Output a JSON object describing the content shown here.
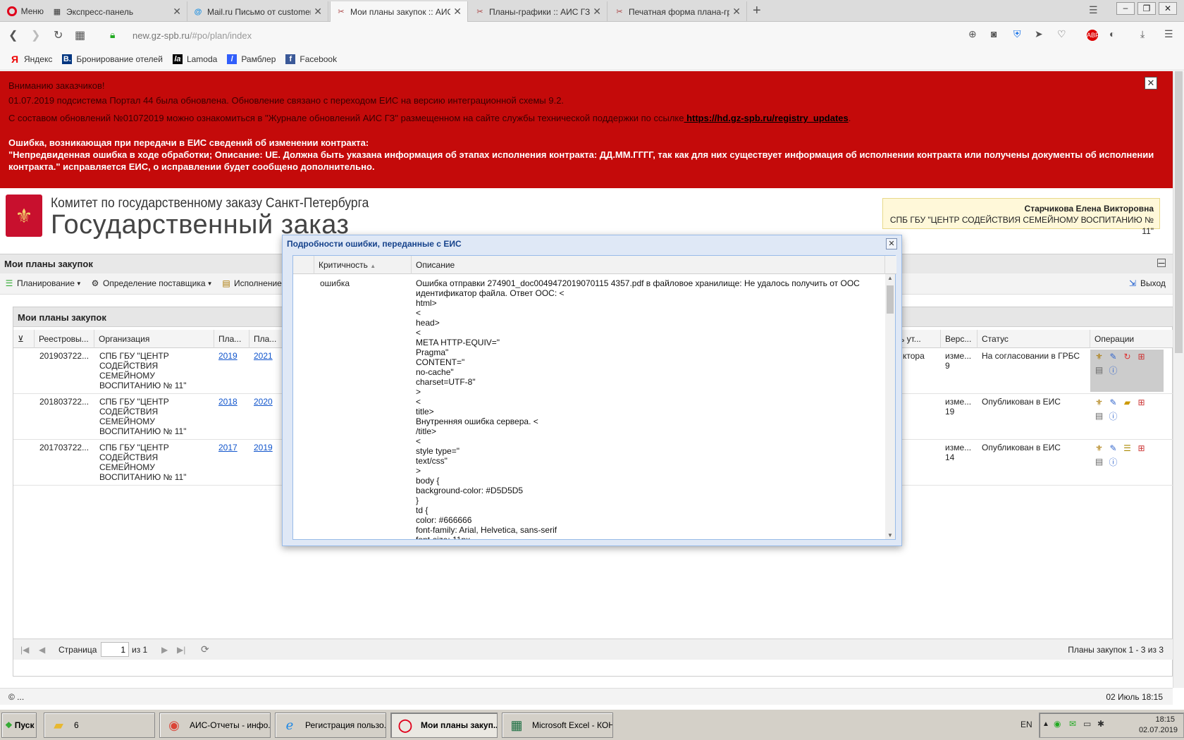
{
  "browser": {
    "menu_label": "Меню",
    "tabs": [
      {
        "title": "Экспресс-панель",
        "icon": "grid-icon"
      },
      {
        "title": "Mail.ru Письмо от customerc",
        "icon": "at-icon"
      },
      {
        "title": "Мои планы закупок :: АИС Г",
        "icon": "tools-icon"
      },
      {
        "title": "Планы-графики :: АИС ГЗ",
        "icon": "tools-icon"
      },
      {
        "title": "Печатная форма плана-граф",
        "icon": "tools-icon"
      }
    ],
    "url_host": "new.gz-spb.ru",
    "url_path": "/#po/plan/index",
    "bookmarks": [
      {
        "label": "Яндекс",
        "color": "#e00"
      },
      {
        "label": "Бронирование отелей",
        "color": "#003580"
      },
      {
        "label": "Lamoda",
        "color": "#000"
      },
      {
        "label": "Рамблер",
        "color": "#315efb"
      },
      {
        "label": "Facebook",
        "color": "#3b5998"
      }
    ]
  },
  "alert": {
    "line1": "Вниманию заказчиков!",
    "line2": "01.07.2019 подсистема Портал 44 была обновлена. Обновление связано с переходом ЕИС на версию интеграционной схемы 9.2.",
    "line3": "С составом обновлений №01072019 можно ознакомиться в \"Журнале обновлений АИС ГЗ\" размещенном на сайте службы технической поддержки по ссылке",
    "link": " https://hd.gz-spb.ru/registry_updates",
    "line3_end": ".",
    "warn_title": "Ошибка, возникающая при передачи в ЕИС сведений об изменении контракта:",
    "warn_body": "\"Непредвиденная ошибка в ходе обработки; Описание: UE. Должна быть указана информация об этапах исполнения контракта: ДД.ММ.ГГГГ, так как для них существует информация об исполнении контракта или получены документы об исполнении контракта.\" исправляется ЕИС, о исправлении будет сообщено дополнительно.",
    "brand_color": "#c40a0a"
  },
  "header": {
    "org_line": "Комитет по государственному заказу Санкт-Петербурга",
    "system_name": "Государственный заказ",
    "user_name": "Старчикова Елена Викторовна",
    "user_org": "СПБ ГБУ \"ЦЕНТР СОДЕЙСТВИЯ СЕМЕЙНОМУ ВОСПИТАНИЮ № 11\""
  },
  "panel": {
    "title": "Мои планы закупок",
    "toolbar": {
      "planning": "Планирование",
      "supplier": "Определение поставщика",
      "execution": "Исполнение",
      "exit": "Выход"
    }
  },
  "grid": {
    "title": "Мои планы закупок",
    "columns": [
      "Реестровы...",
      "Организация",
      "Пла...",
      "Пла...",
      "ь ут...",
      "Верс...",
      "Статус",
      "Операции"
    ],
    "rows": [
      {
        "reg": "201903722...",
        "org": "СПБ ГБУ \"ЦЕНТР\nСОДЕЙСТВИЯ\nСЕМЕЙНОМУ\nВОСПИТАНИЮ № 11\"",
        "y1": "2019",
        "y2": "2021",
        "appr": "ктора",
        "ver": "изме...\n9",
        "status": "На согласовании в ГРБС"
      },
      {
        "reg": "201803722...",
        "org": "СПБ ГБУ \"ЦЕНТР\nСОДЕЙСТВИЯ\nСЕМЕЙНОМУ\nВОСПИТАНИЮ № 11\"",
        "y1": "2018",
        "y2": "2020",
        "appr": "",
        "ver": "изме...\n19",
        "status": "Опубликован в ЕИС"
      },
      {
        "reg": "201703722...",
        "org": "СПБ ГБУ \"ЦЕНТР\nСОДЕЙСТВИЯ\nСЕМЕЙНОМУ\nВОСПИТАНИЮ № 11\"",
        "y1": "2017",
        "y2": "2019",
        "appr": "",
        "ver": "изме...\n14",
        "status": "Опубликован в ЕИС"
      }
    ],
    "pager": {
      "page_label": "Страница",
      "page_value": "1",
      "of_label": "из 1",
      "summary": "Планы закупок 1 - 3 из 3"
    }
  },
  "status": {
    "left": "© ...",
    "right": "02 Июль 18:15"
  },
  "dialog": {
    "title": "Подробности ошибки, переданные с ЕИС",
    "col_severity": "Критичность",
    "col_desc": "Описание",
    "severity": "ошибка",
    "description": "Ошибка отправки 274901_doc0049472019070115 4357.pdf в файловое хранилище: Не удалось получить от ООС\nидентификатор файла. Ответ ООС: <\nhtml>\n<\nhead>\n<\nMETA HTTP-EQUIV=\"\nPragma\"\nCONTENT=\"\nno-cache\"\ncharset=UTF-8\"\n>\n<\ntitle>\nВнутренняя ошибка сервера. <\n/title>\n<\nstyle type=\"\ntext/css\"\n>\nbody {\nbackground-color: #D5D5D5\n}\ntd {\ncolor: #666666\nfont-family: Arial, Helvetica, sans-serif\nfont-size: 11px"
  },
  "taskbar": {
    "start": "Пуск",
    "items": [
      "6",
      "АИС-Отчеты - инфо...",
      "Регистрация пользо...",
      "Мои планы закуп...",
      "Microsoft Excel - КОН..."
    ],
    "lang": "EN",
    "time": "18:15",
    "date": "02.07.2019"
  }
}
